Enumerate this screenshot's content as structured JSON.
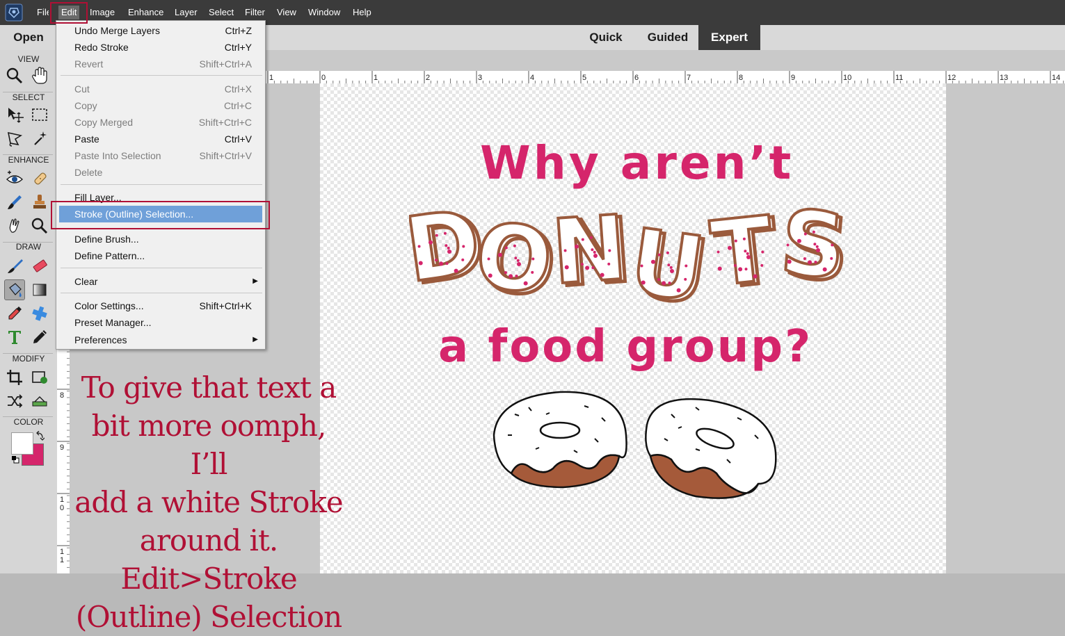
{
  "menubar": {
    "items": [
      "File",
      "Edit",
      "Image",
      "Enhance",
      "Layer",
      "Select",
      "Filter",
      "View",
      "Window",
      "Help"
    ],
    "active": "Edit"
  },
  "modebar": {
    "open_label": "Open",
    "tabs": [
      "Quick",
      "Guided",
      "Expert"
    ],
    "active_tab": "Expert"
  },
  "toolbox": {
    "sections": {
      "view": "VIEW",
      "select": "SELECT",
      "enhance": "ENHANCE",
      "draw": "DRAW",
      "modify": "MODIFY",
      "color": "COLOR"
    },
    "foreground_color": "#d5256b",
    "background_color": "#ffffff"
  },
  "rulers": {
    "horizontal": [
      "1",
      "0",
      "1",
      "2",
      "3",
      "4",
      "5",
      "6",
      "7",
      "8",
      "9",
      "10",
      "11",
      "12",
      "13",
      "14"
    ],
    "vertical": [
      "8",
      "9",
      "1 0",
      "1 1"
    ]
  },
  "edit_menu": {
    "items": [
      {
        "label": "Undo Merge Layers",
        "shortcut": "Ctrl+Z",
        "enabled": true
      },
      {
        "label": "Redo Stroke",
        "shortcut": "Ctrl+Y",
        "enabled": true
      },
      {
        "label": "Revert",
        "shortcut": "Shift+Ctrl+A",
        "enabled": false
      },
      {
        "label": "Cut",
        "shortcut": "Ctrl+X",
        "enabled": false
      },
      {
        "label": "Copy",
        "shortcut": "Ctrl+C",
        "enabled": false
      },
      {
        "label": "Copy Merged",
        "shortcut": "Shift+Ctrl+C",
        "enabled": false
      },
      {
        "label": "Paste",
        "shortcut": "Ctrl+V",
        "enabled": true
      },
      {
        "label": "Paste Into Selection",
        "shortcut": "Shift+Ctrl+V",
        "enabled": false
      },
      {
        "label": "Delete",
        "shortcut": "",
        "enabled": false
      },
      {
        "label": "Fill Layer...",
        "shortcut": "",
        "enabled": true
      },
      {
        "label": "Stroke (Outline) Selection...",
        "shortcut": "",
        "enabled": true,
        "highlighted": true
      },
      {
        "label": "Define Brush...",
        "shortcut": "",
        "enabled": true
      },
      {
        "label": "Define Pattern...",
        "shortcut": "",
        "enabled": true
      },
      {
        "label": "Clear",
        "shortcut": "",
        "enabled": true,
        "submenu": true
      },
      {
        "label": "Color Settings...",
        "shortcut": "Shift+Ctrl+K",
        "enabled": true
      },
      {
        "label": "Preset Manager...",
        "shortcut": "",
        "enabled": true
      },
      {
        "label": "Preferences",
        "shortcut": "",
        "enabled": true,
        "submenu": true
      }
    ]
  },
  "artwork": {
    "line1": "Why aren’t",
    "line2": "DONUTS",
    "line3": "a food group?",
    "text_color": "#d5256b",
    "outline_color": "#9a5a3c"
  },
  "caption": {
    "lines": [
      "To give that text a",
      "bit more oomph, I’ll",
      "add a white Stroke",
      "around it. Edit>Stroke",
      "(Outline) Selection"
    ],
    "color": "#b01035"
  }
}
